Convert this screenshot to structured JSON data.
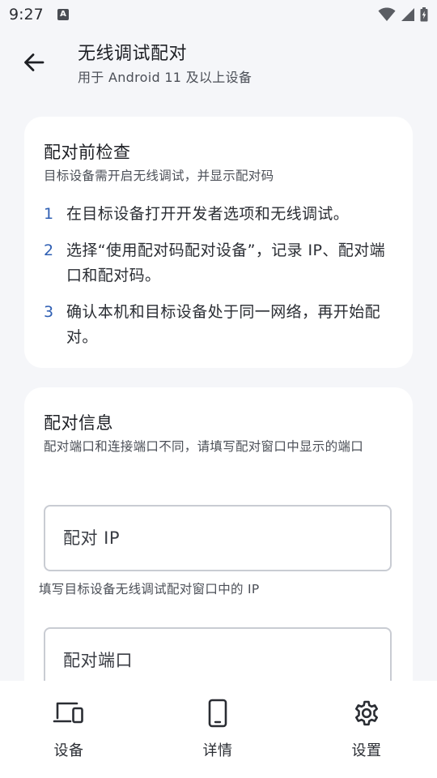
{
  "status_bar": {
    "time": "9:27",
    "app_icon_letter": "A",
    "icons": [
      "wifi-icon",
      "signal-icon",
      "battery-icon"
    ]
  },
  "header": {
    "back_icon": "arrow-back-icon",
    "title": "无线调试配对",
    "subtitle": "用于 Android 11 及以上设备"
  },
  "precheck_card": {
    "title": "配对前检查",
    "description": "目标设备需开启无线调试，并显示配对码",
    "steps": [
      {
        "number": "1",
        "text": "在目标设备打开开发者选项和无线调试。"
      },
      {
        "number": "2",
        "text": "选择“使用配对码配对设备”，记录 IP、配对端口和配对码。"
      },
      {
        "number": "3",
        "text": "确认本机和目标设备处于同一网络，再开始配对。"
      }
    ]
  },
  "pairing_card": {
    "title": "配对信息",
    "description": "配对端口和连接端口不同，请填写配对窗口中显示的端口",
    "ip_field": {
      "placeholder": "配对 IP",
      "value": "",
      "helper": "填写目标设备无线调试配对窗口中的 IP"
    },
    "port_field": {
      "placeholder": "配对端口",
      "value": ""
    }
  },
  "bottom_nav": {
    "items": [
      {
        "label": "设备",
        "icon": "devices-icon"
      },
      {
        "label": "详情",
        "icon": "phone-icon"
      },
      {
        "label": "设置",
        "icon": "gear-icon"
      }
    ]
  },
  "colors": {
    "background": "#f5f6f9",
    "card": "#ffffff",
    "accent": "#2f5fb3",
    "text_primary": "#1d1f24",
    "text_secondary": "#4b4f57",
    "field_border": "#c9ccd3"
  }
}
